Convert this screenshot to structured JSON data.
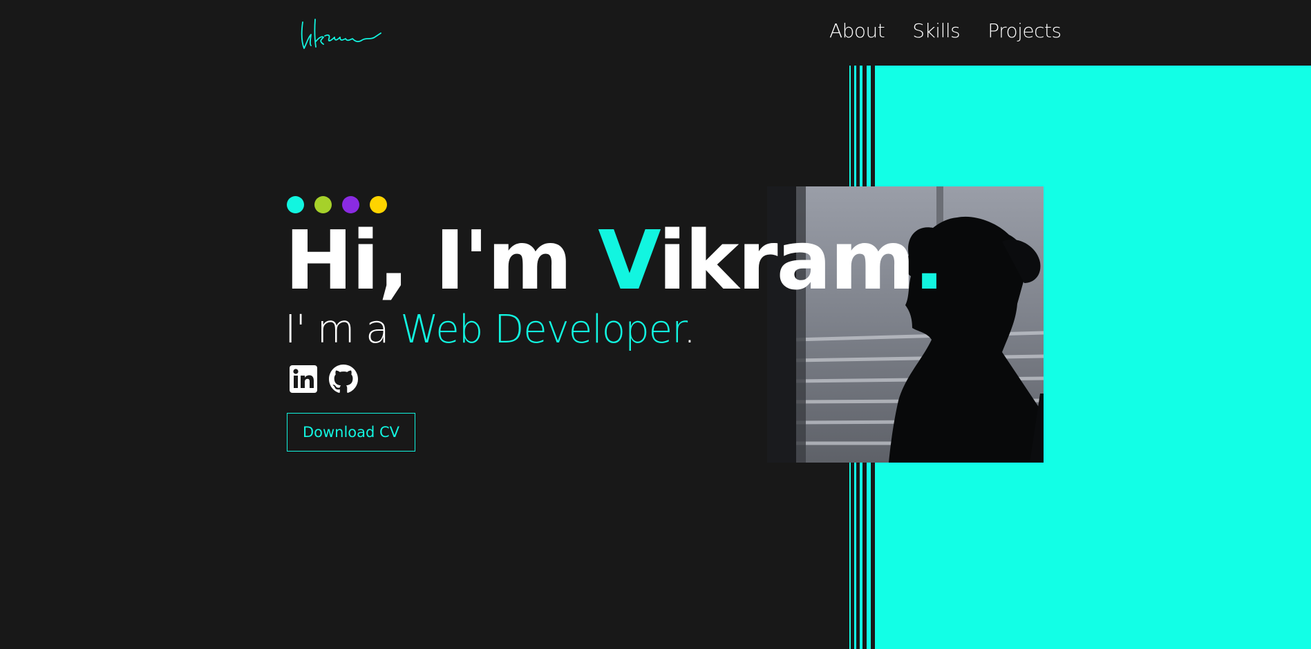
{
  "brand": {
    "logo_name": "signature-logo",
    "accent_color": "#12f5e0",
    "background_color": "#181818"
  },
  "nav": {
    "items": [
      {
        "label": "About"
      },
      {
        "label": "Skills"
      },
      {
        "label": "Projects"
      }
    ]
  },
  "hero": {
    "dots": [
      {
        "color": "#12f5e0"
      },
      {
        "color": "#a6d12a"
      },
      {
        "color": "#8a2be2"
      },
      {
        "color": "#ffd400"
      }
    ],
    "greeting_prefix": "Hi, I'm ",
    "name_initial": "V",
    "name_rest": "ikram",
    "name_period": ".",
    "subtitle_prefix": "I' m a ",
    "role": "Web Developer",
    "subtitle_suffix": ".",
    "socials": [
      {
        "icon": "linkedin-icon"
      },
      {
        "icon": "github-icon"
      }
    ],
    "cv_button_label": "Download CV"
  }
}
